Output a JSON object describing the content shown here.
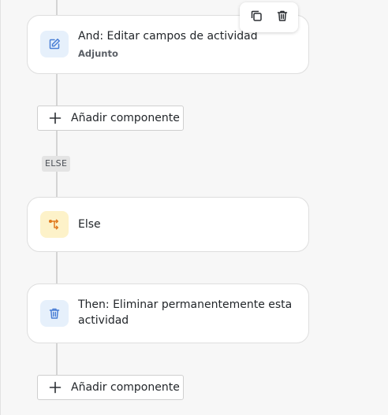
{
  "workflow": {
    "step_edit": {
      "title": "And: Editar campos de actividad",
      "subtitle": "Adjunto",
      "icon": "edit-icon"
    },
    "toolbar": {
      "duplicate_icon": "copy-icon",
      "delete_icon": "trash-icon"
    },
    "add_component_label": "Añadir componente",
    "else_tag": "ELSE",
    "step_else": {
      "title": "Else",
      "icon": "branch-icon"
    },
    "step_delete": {
      "title": "Then: Eliminar permanentemente esta actividad",
      "icon": "trash-icon"
    },
    "colors": {
      "blue_icon": "#4a7fd6",
      "blue_icon_bg": "#e6f0fb",
      "orange_icon": "#e07a1f",
      "yellow_icon_bg": "#fdf2c9"
    }
  }
}
